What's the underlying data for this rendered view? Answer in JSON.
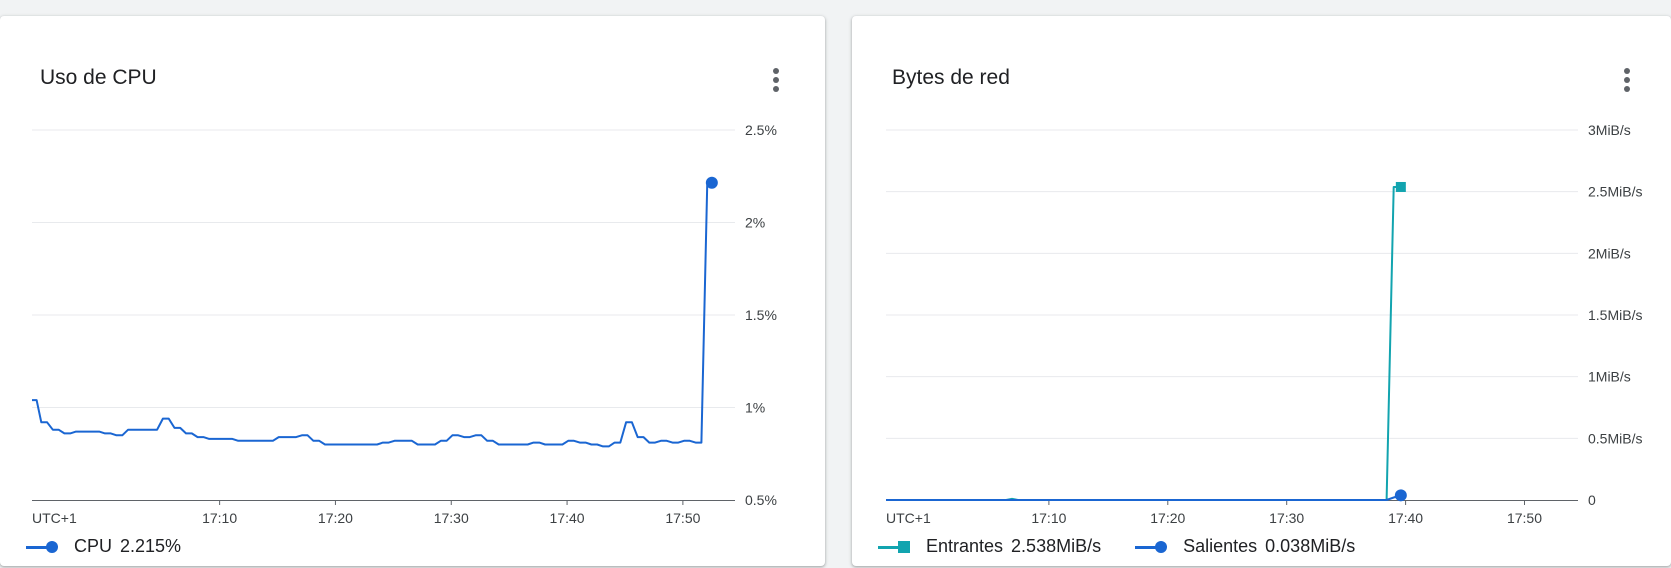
{
  "colors": {
    "cpu": "#1a66d2",
    "entrantes": "#12a4af",
    "salientes": "#1a66d2",
    "grid": "#e8eaed",
    "axis": "#5f6368"
  },
  "cpu_card": {
    "title": "Uso de CPU",
    "menu_icon": "more-vert-icon",
    "legend": [
      {
        "name": "CPU",
        "value": "2.215%",
        "marker": "circle",
        "color": "#1a66d2"
      }
    ]
  },
  "net_card": {
    "title": "Bytes de red",
    "menu_icon": "more-vert-icon",
    "legend": [
      {
        "name": "Entrantes",
        "value": "2.538MiB/s",
        "marker": "square",
        "color": "#12a4af"
      },
      {
        "name": "Salientes",
        "value": "0.038MiB/s",
        "marker": "circle",
        "color": "#1a66d2"
      }
    ]
  },
  "chart_data": [
    {
      "type": "line",
      "title": "Uso de CPU",
      "timezone_label": "UTC+1",
      "x_ticks": [
        "17:10",
        "17:20",
        "17:30",
        "17:40",
        "17:50"
      ],
      "y_ticks": [
        "0.5%",
        "1%",
        "1.5%",
        "2%",
        "2.5%"
      ],
      "ylim": [
        0.5,
        2.5
      ],
      "xlim_minutes": [
        -16.2,
        44.5
      ],
      "grid": true,
      "y_axis_side": "right",
      "legend_placement": "bottom-left",
      "series": [
        {
          "name": "CPU",
          "color": "#1a66d2",
          "marker": "circle",
          "points": [
            [
              -16.2,
              1.04
            ],
            [
              -15.8,
              1.04
            ],
            [
              -15.4,
              0.92
            ],
            [
              -14.9,
              0.92
            ],
            [
              -14.4,
              0.88
            ],
            [
              -13.9,
              0.88
            ],
            [
              -13.4,
              0.86
            ],
            [
              -12.9,
              0.86
            ],
            [
              -12.4,
              0.87
            ],
            [
              -11.4,
              0.87
            ],
            [
              -10.4,
              0.87
            ],
            [
              -9.9,
              0.86
            ],
            [
              -9.4,
              0.86
            ],
            [
              -8.9,
              0.85
            ],
            [
              -8.4,
              0.85
            ],
            [
              -7.9,
              0.88
            ],
            [
              -6.9,
              0.88
            ],
            [
              -5.9,
              0.88
            ],
            [
              -5.4,
              0.88
            ],
            [
              -4.9,
              0.94
            ],
            [
              -4.4,
              0.94
            ],
            [
              -3.9,
              0.89
            ],
            [
              -3.4,
              0.89
            ],
            [
              -2.9,
              0.86
            ],
            [
              -2.4,
              0.86
            ],
            [
              -1.9,
              0.84
            ],
            [
              -1.4,
              0.84
            ],
            [
              -0.9,
              0.83
            ],
            [
              0.1,
              0.83
            ],
            [
              1.1,
              0.83
            ],
            [
              1.6,
              0.82
            ],
            [
              3.1,
              0.82
            ],
            [
              4.6,
              0.82
            ],
            [
              5.1,
              0.84
            ],
            [
              6.1,
              0.84
            ],
            [
              6.6,
              0.84
            ],
            [
              7.1,
              0.85
            ],
            [
              7.6,
              0.85
            ],
            [
              8.1,
              0.82
            ],
            [
              8.6,
              0.82
            ],
            [
              9.1,
              0.8
            ],
            [
              10.6,
              0.8
            ],
            [
              12.1,
              0.8
            ],
            [
              13.6,
              0.8
            ],
            [
              14.1,
              0.81
            ],
            [
              14.6,
              0.81
            ],
            [
              15.1,
              0.82
            ],
            [
              15.6,
              0.82
            ],
            [
              16.1,
              0.82
            ],
            [
              16.6,
              0.82
            ],
            [
              17.1,
              0.8
            ],
            [
              18.1,
              0.8
            ],
            [
              18.6,
              0.8
            ],
            [
              19.1,
              0.82
            ],
            [
              19.6,
              0.82
            ],
            [
              20.1,
              0.85
            ],
            [
              20.6,
              0.85
            ],
            [
              21.1,
              0.84
            ],
            [
              21.6,
              0.84
            ],
            [
              22.1,
              0.85
            ],
            [
              22.6,
              0.85
            ],
            [
              23.1,
              0.82
            ],
            [
              23.6,
              0.82
            ],
            [
              24.1,
              0.8
            ],
            [
              25.1,
              0.8
            ],
            [
              26.1,
              0.8
            ],
            [
              26.6,
              0.8
            ],
            [
              27.1,
              0.81
            ],
            [
              27.6,
              0.81
            ],
            [
              28.1,
              0.8
            ],
            [
              28.6,
              0.8
            ],
            [
              29.1,
              0.8
            ],
            [
              29.6,
              0.8
            ],
            [
              30.1,
              0.82
            ],
            [
              30.6,
              0.82
            ],
            [
              31.1,
              0.81
            ],
            [
              31.6,
              0.81
            ],
            [
              32.1,
              0.8
            ],
            [
              32.6,
              0.8
            ],
            [
              33.1,
              0.79
            ],
            [
              33.6,
              0.79
            ],
            [
              34.1,
              0.81
            ],
            [
              34.6,
              0.81
            ],
            [
              35.1,
              0.92
            ],
            [
              35.6,
              0.92
            ],
            [
              36.1,
              0.84
            ],
            [
              36.6,
              0.84
            ],
            [
              37.1,
              0.81
            ],
            [
              37.6,
              0.81
            ],
            [
              38.1,
              0.82
            ],
            [
              38.6,
              0.82
            ],
            [
              39.1,
              0.81
            ],
            [
              39.6,
              0.81
            ],
            [
              40.1,
              0.82
            ],
            [
              40.6,
              0.82
            ],
            [
              41.1,
              0.81
            ],
            [
              41.6,
              0.81
            ],
            [
              42.1,
              2.2
            ],
            [
              42.5,
              2.215
            ]
          ],
          "last_value": 2.215
        }
      ]
    },
    {
      "type": "line",
      "title": "Bytes de red",
      "timezone_label": "UTC+1",
      "x_ticks": [
        "17:10",
        "17:20",
        "17:30",
        "17:40",
        "17:50"
      ],
      "y_ticks": [
        "0",
        "0.5MiB/s",
        "1MiB/s",
        "1.5MiB/s",
        "2MiB/s",
        "2.5MiB/s",
        "3MiB/s"
      ],
      "ylim": [
        0,
        3
      ],
      "xlim_minutes": [
        -13.7,
        44.5
      ],
      "grid": true,
      "y_axis_side": "right",
      "legend_placement": "bottom-left",
      "series": [
        {
          "name": "Entrantes",
          "color": "#12a4af",
          "marker": "square",
          "points": [
            [
              -13.7,
              0.0
            ],
            [
              -3.6,
              0.0
            ],
            [
              -3.1,
              0.01
            ],
            [
              -2.6,
              0.0
            ],
            [
              27.9,
              0.0
            ],
            [
              28.4,
              0.0
            ],
            [
              29.0,
              2.538
            ],
            [
              29.6,
              2.538
            ]
          ],
          "last_value": 2.538
        },
        {
          "name": "Salientes",
          "color": "#1a66d2",
          "marker": "circle",
          "points": [
            [
              -13.7,
              0.0
            ],
            [
              28.4,
              0.0
            ],
            [
              29.0,
              0.02
            ],
            [
              29.6,
              0.038
            ]
          ],
          "last_value": 0.038
        }
      ]
    }
  ]
}
